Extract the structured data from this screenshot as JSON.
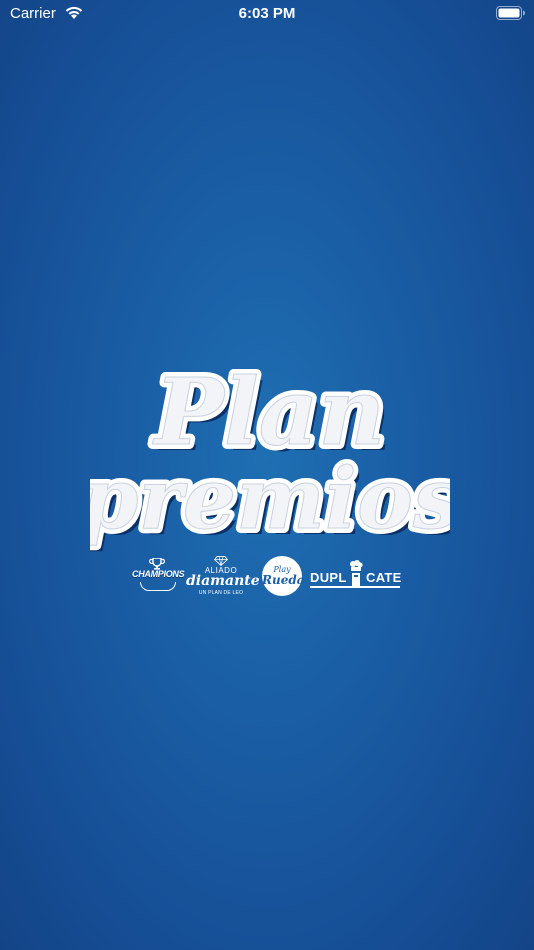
{
  "status_bar": {
    "carrier": "Carrier",
    "time": "6:03 PM",
    "wifi_icon": "wifi-icon",
    "battery_icon": "battery-icon"
  },
  "splash": {
    "logo_line1": "Plan",
    "logo_line2": "premios",
    "colors": {
      "background": "#1a5fa6",
      "logo_text": "#ffffff",
      "logo_shadow": "#0c2f66"
    }
  },
  "sponsors": {
    "champions": {
      "label": "CHAMPIONS",
      "icon": "trophy-icon"
    },
    "aliado": {
      "top": "ALIADO",
      "script": "diamante",
      "sub": "UN PLAN DE LEO",
      "icon": "diamond-icon"
    },
    "play": {
      "line1": "Play",
      "line2": "Rueda"
    },
    "duplicate": {
      "left": "DUPL",
      "right": "CATE",
      "icon": "chef-hat-icon"
    }
  }
}
